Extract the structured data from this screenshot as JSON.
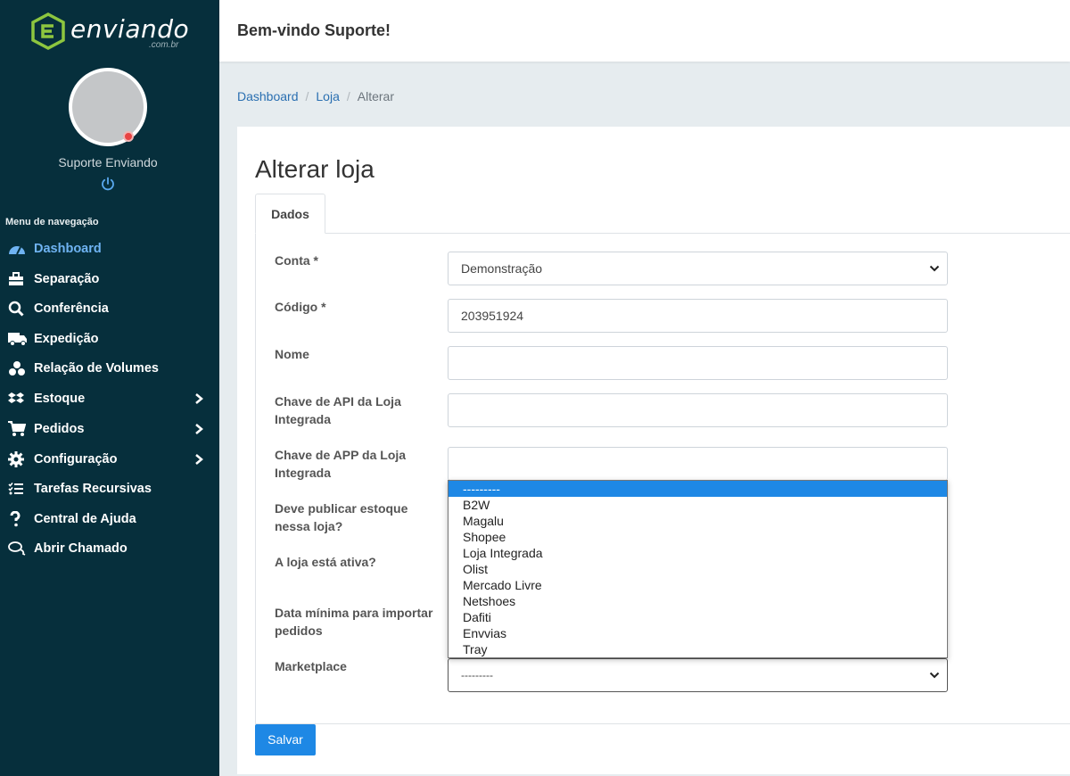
{
  "brand": {
    "name": "enviando",
    "suffix": ".com.br",
    "accent": "#8dc63f"
  },
  "user": {
    "name": "Suporte Enviando",
    "status_color": "#e84343"
  },
  "sidebar": {
    "menu_title": "Menu de navegação",
    "items": [
      {
        "label": "Dashboard",
        "icon": "dashboard-icon",
        "active": true
      },
      {
        "label": "Separação",
        "icon": "toolbox-icon"
      },
      {
        "label": "Conferência",
        "icon": "search-icon"
      },
      {
        "label": "Expedição",
        "icon": "truck-icon"
      },
      {
        "label": "Relação de Volumes",
        "icon": "boxes-icon"
      },
      {
        "label": "Estoque",
        "icon": "dropbox-icon",
        "has_submenu": true
      },
      {
        "label": "Pedidos",
        "icon": "cart-icon",
        "has_submenu": true
      },
      {
        "label": "Configuração",
        "icon": "gear-icon",
        "has_submenu": true
      },
      {
        "label": "Tarefas Recursivas",
        "icon": "tasks-icon"
      },
      {
        "label": "Central de Ajuda",
        "icon": "question-icon"
      },
      {
        "label": "Abrir Chamado",
        "icon": "comments-icon"
      }
    ]
  },
  "header": {
    "welcome": "Bem-vindo Suporte!"
  },
  "breadcrumb": {
    "items": [
      "Dashboard",
      "Loja",
      "Alterar"
    ]
  },
  "page": {
    "title": "Alterar loja",
    "tab": "Dados",
    "save_label": "Salvar"
  },
  "form": {
    "conta_label": "Conta *",
    "conta_value": "Demonstração",
    "codigo_label": "Código *",
    "codigo_value": "203951924",
    "nome_label": "Nome",
    "api_label": "Chave de API da Loja Integrada",
    "app_label": "Chave de APP da Loja Integrada",
    "estoque_label": "Deve publicar estoque nessa loja?",
    "ativa_label": "A loja está ativa?",
    "data_label": "Data mínima para importar pedidos",
    "marketplace_label": "Marketplace",
    "marketplace_value": "---------"
  },
  "marketplace_options": [
    "---------",
    "B2W",
    "Magalu",
    "Shopee",
    "Loja Integrada",
    "Olist",
    "Mercado Livre",
    "Netshoes",
    "Dafiti",
    "Envvias",
    "Tray"
  ]
}
